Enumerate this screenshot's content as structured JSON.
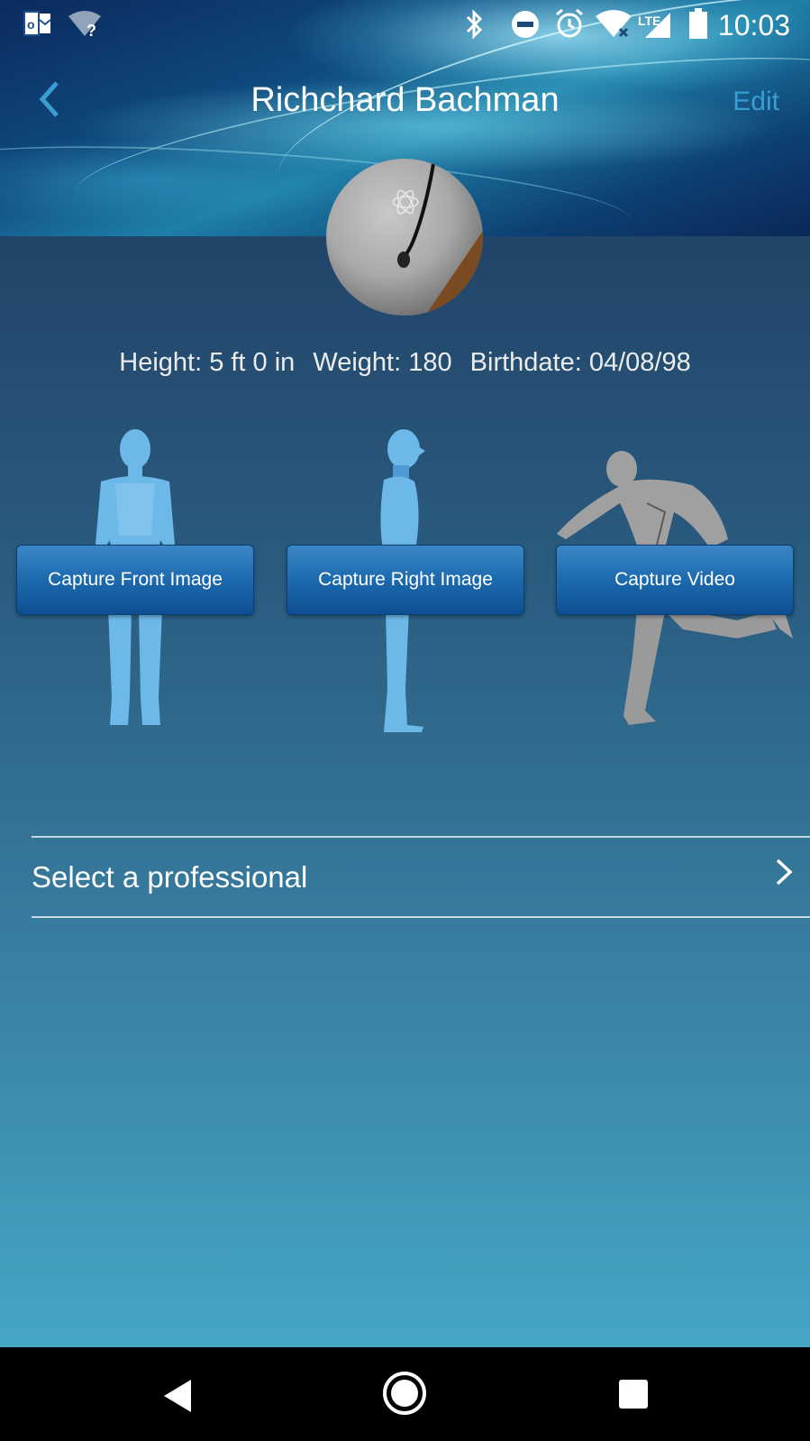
{
  "status_bar": {
    "time": "10:03",
    "network": "LTE",
    "icons": [
      "outlook-icon",
      "wifi-unknown-icon",
      "bluetooth-icon",
      "do-not-disturb-icon",
      "alarm-icon",
      "wifi-icon",
      "signal-icon",
      "battery-icon"
    ]
  },
  "header": {
    "title": "Richchard Bachman",
    "back_icon": "back-chevron-icon",
    "edit_label": "Edit"
  },
  "profile": {
    "height": "Height: 5 ft 0 in",
    "weight": "Weight: 180",
    "birthdate": "Birthdate: 04/08/98"
  },
  "captures": [
    {
      "label": "Capture Front Image",
      "figure": "front-body-figure"
    },
    {
      "label": "Capture Right Image",
      "figure": "side-body-figure"
    },
    {
      "label": "Capture Video",
      "figure": "running-figure"
    }
  ],
  "professional": {
    "label": "Select a professional",
    "chevron": "chevron-right-icon"
  },
  "colors": {
    "accent": "#3a9fd0",
    "button_top": "#3a86c6",
    "button_bottom": "#0e4f92",
    "body_figure": "#6cb8e8",
    "video_figure": "#a0a0a0"
  }
}
